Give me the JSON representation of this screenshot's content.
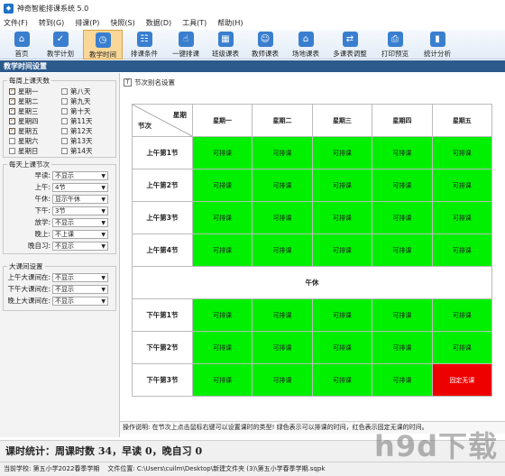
{
  "window": {
    "title": "神奇智能排课系统 5.0"
  },
  "menu": [
    "文件(F)",
    "转到(G)",
    "排课(P)",
    "快照(S)",
    "数据(D)",
    "工具(T)",
    "帮助(H)"
  ],
  "toolbar": [
    {
      "label": "首页",
      "icon": "home-icon",
      "glyph": "⌂"
    },
    {
      "label": "教学计划",
      "icon": "clipboard-icon",
      "glyph": "✓"
    },
    {
      "label": "教学时间",
      "icon": "clock-icon",
      "glyph": "◷",
      "active": true
    },
    {
      "label": "排课条件",
      "icon": "users-icon",
      "glyph": "☷"
    },
    {
      "label": "一键排课",
      "icon": "hand-icon",
      "glyph": "☝"
    },
    {
      "label": "班级课表",
      "icon": "grid-icon",
      "glyph": "▦"
    },
    {
      "label": "教师课表",
      "icon": "teacher-icon",
      "glyph": "☺"
    },
    {
      "label": "场地课表",
      "icon": "building-icon",
      "glyph": "⌂"
    },
    {
      "label": "多课表调整",
      "icon": "adjust-icon",
      "glyph": "⇄"
    },
    {
      "label": "打印预览",
      "icon": "printer-icon",
      "glyph": "⎙"
    },
    {
      "label": "统计分析",
      "icon": "chart-icon",
      "glyph": "▮"
    }
  ],
  "section_title": "教学时间设置",
  "days_group": {
    "title": "每周上课天数",
    "col1": [
      {
        "label": "星期一",
        "checked": true
      },
      {
        "label": "星期二",
        "checked": true
      },
      {
        "label": "星期三",
        "checked": true
      },
      {
        "label": "星期四",
        "checked": true
      },
      {
        "label": "星期五",
        "checked": true
      },
      {
        "label": "星期六",
        "checked": false
      },
      {
        "label": "星期日",
        "checked": false
      }
    ],
    "col2": [
      {
        "label": "第八天",
        "checked": false
      },
      {
        "label": "第九天",
        "checked": false
      },
      {
        "label": "第十天",
        "checked": false
      },
      {
        "label": "第11天",
        "checked": false
      },
      {
        "label": "第12天",
        "checked": false
      },
      {
        "label": "第13天",
        "checked": false
      },
      {
        "label": "第14天",
        "checked": false
      }
    ]
  },
  "periods_group": {
    "title": "每天上课节次",
    "fields": [
      {
        "label": "早读:",
        "value": "不显示"
      },
      {
        "label": "上午:",
        "value": "4节"
      },
      {
        "label": "午休:",
        "value": "显示午休"
      },
      {
        "label": "下午:",
        "value": "3节"
      },
      {
        "label": "放学:",
        "value": "不显示"
      },
      {
        "label": "晚上:",
        "value": "不上课"
      },
      {
        "label": "晚自习:",
        "value": "不显示"
      }
    ]
  },
  "break_group": {
    "title": "大课间设置",
    "fields": [
      {
        "label": "上午大课间在:",
        "value": "不显示"
      },
      {
        "label": "下午大课间在:",
        "value": "不显示"
      },
      {
        "label": "晚上大课间在:",
        "value": "不显示"
      }
    ]
  },
  "alias_label": "节次别名设置",
  "grid": {
    "corner_top": "星期",
    "corner_bottom": "节次",
    "days": [
      "星期一",
      "星期二",
      "星期三",
      "星期四",
      "星期五"
    ],
    "morning": [
      {
        "period": "上午第1节",
        "slots": [
          "可排课",
          "可排课",
          "可排课",
          "可排课",
          "可排课"
        ]
      },
      {
        "period": "上午第2节",
        "slots": [
          "可排课",
          "可排课",
          "可排课",
          "可排课",
          "可排课"
        ]
      },
      {
        "period": "上午第3节",
        "slots": [
          "可排课",
          "可排课",
          "可排课",
          "可排课",
          "可排课"
        ]
      },
      {
        "period": "上午第4节",
        "slots": [
          "可排课",
          "可排课",
          "可排课",
          "可排课",
          "可排课"
        ]
      }
    ],
    "noon_label": "午休",
    "afternoon": [
      {
        "period": "下午第1节",
        "slots": [
          "可排课",
          "可排课",
          "可排课",
          "可排课",
          "可排课"
        ]
      },
      {
        "period": "下午第2节",
        "slots": [
          "可排课",
          "可排课",
          "可排课",
          "可排课",
          "可排课"
        ]
      },
      {
        "period": "下午第3节",
        "slots": [
          "可排课",
          "可排课",
          "可排课",
          "可排课",
          "固定无课"
        ]
      }
    ],
    "blocked_value": "固定无课",
    "colors": {
      "available": "#00f000",
      "blocked": "#ef0000"
    }
  },
  "instructions": "操作说明: 在节次上点击鼠标右键可以设置课时的类型! 绿色表示可以排课的时间，红色表示固定无课的时间。",
  "stats": "课时统计：周课时数 34，早读 0，晚自习 0",
  "status": {
    "school_label": "当前学校:",
    "school": "第五小学2022春季学期",
    "location_label": "文件位置:",
    "path": "C:\\Users\\cuilm\\Desktop\\新建文件夹 (3)\\第五小学春季学期.sqpk"
  },
  "watermark": "h9d下载"
}
